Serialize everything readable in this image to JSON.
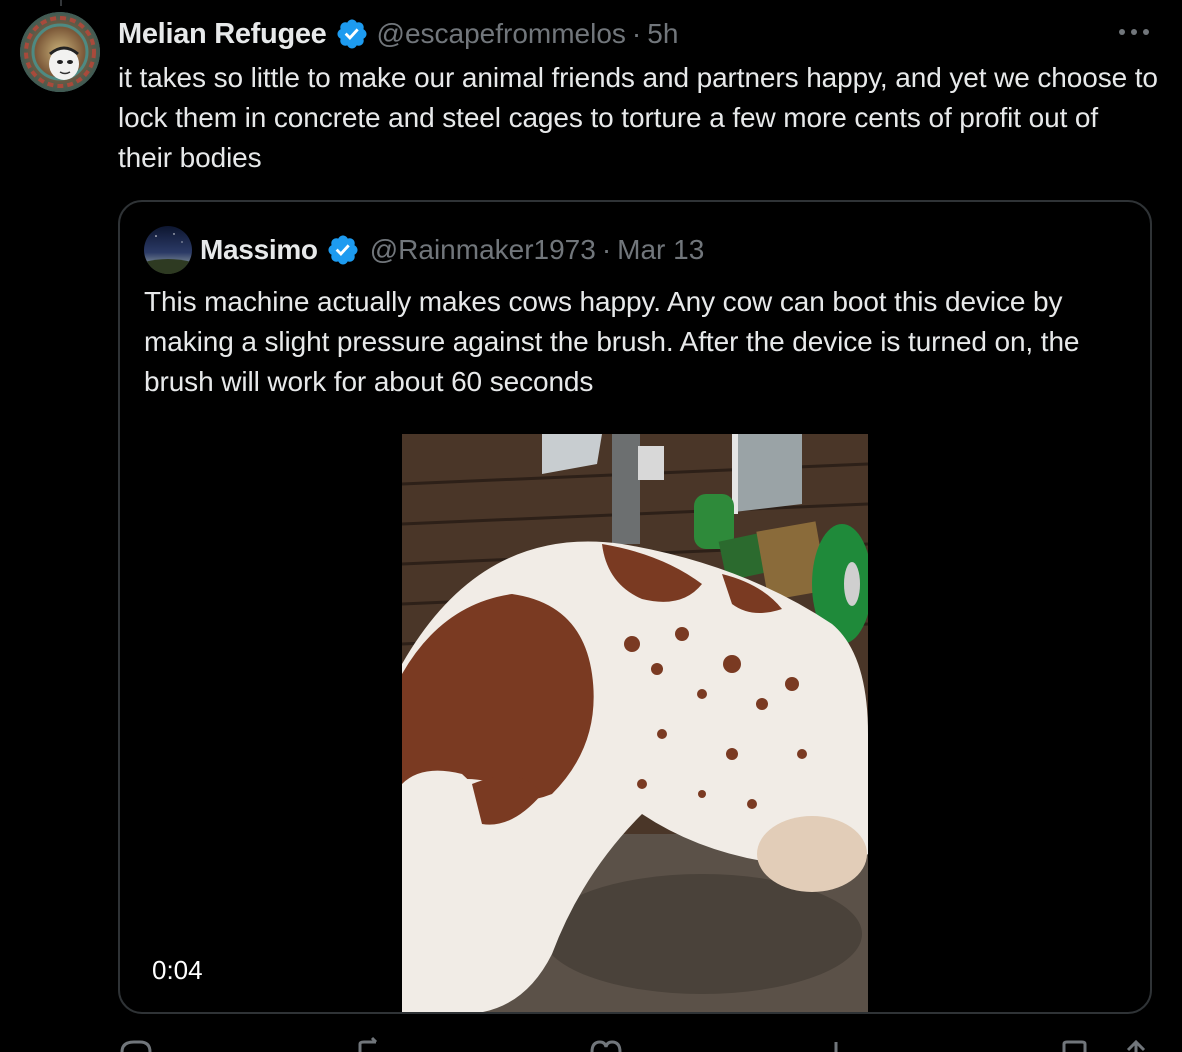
{
  "tweet": {
    "author_name": "Melian Refugee",
    "author_handle": "@escapefrommelos",
    "separator": "·",
    "timestamp": "5h",
    "more_label": "···",
    "text": "it takes so little to make our animal friends and partners happy, and yet we choose to lock them in concrete and steel cages to torture a few more cents of profit out of their bodies"
  },
  "quoted_tweet": {
    "author_name": "Massimo",
    "author_handle": "@Rainmaker1973",
    "separator": "·",
    "timestamp": "Mar 13",
    "text": "This machine actually makes cows happy. Any cow can boot this device by making a slight pressure against the brush. After the device is turned on, the brush will work for about 60 seconds",
    "video_duration": "0:04"
  },
  "icons": {
    "verified": "verified-badge-icon",
    "more": "more-options-icon",
    "reply": "reply-icon",
    "retweet": "retweet-icon",
    "like": "like-icon",
    "views": "views-icon",
    "bookmark": "bookmark-icon",
    "share": "share-icon"
  },
  "colors": {
    "background": "#000000",
    "text_primary": "#e7e9ea",
    "text_secondary": "#71767b",
    "verified": "#1d9bf0",
    "border": "#2f3336"
  }
}
